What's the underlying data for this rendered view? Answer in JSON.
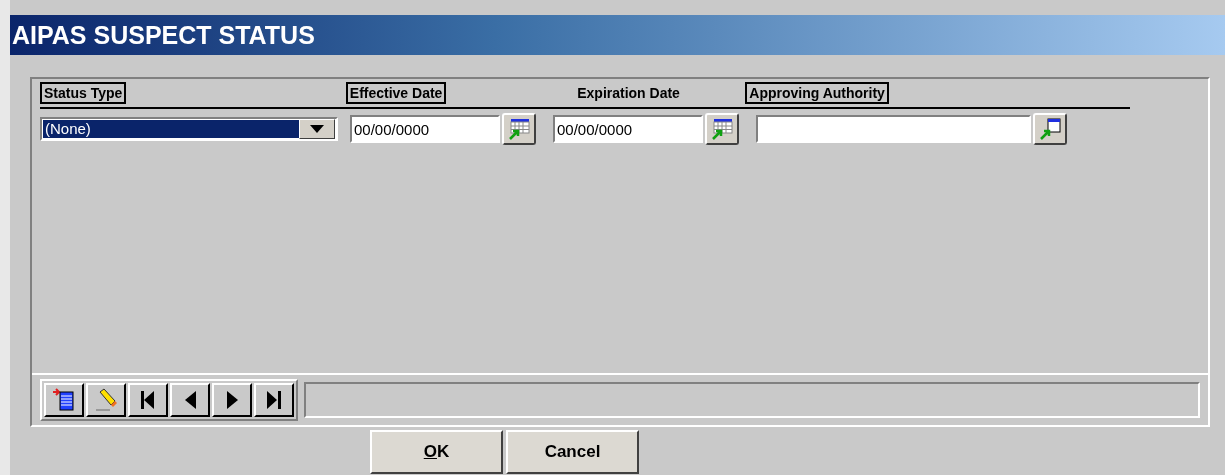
{
  "window": {
    "title": "AIPAS SUSPECT STATUS"
  },
  "columns": [
    {
      "label": "Status Type",
      "outlined": true
    },
    {
      "label": "Effective Date",
      "outlined": true
    },
    {
      "label": "Expiration Date",
      "outlined": false
    },
    {
      "label": "Approving Authority",
      "outlined": true
    }
  ],
  "row": {
    "status_type": {
      "value": "(None)",
      "selected": true
    },
    "effective_date": "00/00/0000",
    "expiration_date": "00/00/0000"
  },
  "buttons": [
    {
      "label": "OK",
      "underline_first_letter": true
    },
    {
      "label": "Cancel",
      "underline_first_letter": false
    }
  ]
}
